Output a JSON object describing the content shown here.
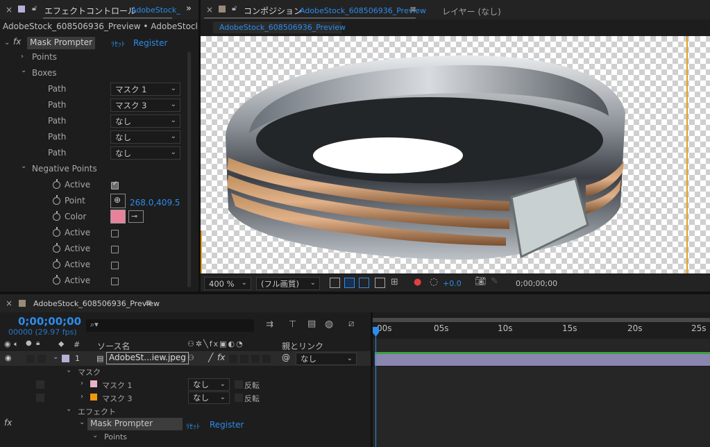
{
  "effect_panel": {
    "tab_title": "エフェクトコントロール",
    "tab_source": "AdobeStock_",
    "breadcrumb": "AdobeStock_608506936_Preview • AdobeStock_60",
    "effect_name": "Mask Prompter",
    "reset": "ﾘｾｯﾄ",
    "register": "Register",
    "points": "Points",
    "boxes": "Boxes",
    "path_rows": [
      {
        "label": "Path",
        "value": "マスク 1"
      },
      {
        "label": "Path",
        "value": "マスク 3"
      },
      {
        "label": "Path",
        "value": "なし"
      },
      {
        "label": "Path",
        "value": "なし"
      },
      {
        "label": "Path",
        "value": "なし"
      }
    ],
    "negative_points": "Negative Points",
    "active1": "Active",
    "point_label": "Point",
    "point_value": "268.0,409.5",
    "color_label": "Color",
    "color_value": "#e8829a",
    "active_rows": [
      "Active",
      "Active",
      "Active",
      "Active"
    ]
  },
  "comp_panel": {
    "tab_title": "コンポジション",
    "tab_source": "AdobeStock_608506936_Preview",
    "layer_tab": "レイヤー (なし)",
    "sub_tab": "AdobeStock_608506936_Preview",
    "zoom": "400 %",
    "resolution": "(フル画質)",
    "exposure": "+0.0",
    "timecode": "0;00;00;00"
  },
  "timeline": {
    "tab_title": "AdobeStock_608506936_Preview",
    "timecode": "0;00;00;00",
    "frames": "00000 (29.97 fps)",
    "search_placeholder": "",
    "col_source": "ソース名",
    "col_parent": "親とリンク",
    "col_num": "#",
    "ruler": [
      "00s",
      "05s",
      "10s",
      "15s",
      "20s",
      "25s"
    ],
    "layer": {
      "num": "1",
      "name": "AdobeSt...iew.jpeg",
      "parent": "なし"
    },
    "mask_group": "マスク",
    "masks": [
      {
        "name": "マスク 1",
        "mode": "なし",
        "invert": "反転",
        "color": "#e8b4c8"
      },
      {
        "name": "マスク 3",
        "mode": "なし",
        "invert": "反転",
        "color": "#f0960f"
      }
    ],
    "effect_group": "エフェクト",
    "effect_name": "Mask Prompter",
    "reset": "ﾘｾｯﾄ",
    "register": "Register",
    "points": "Points"
  },
  "colors": {
    "accent": "#2d8ceb",
    "layer_bar": "#8a86b0",
    "mask1": "#e8b4c8",
    "mask3": "#f0960f"
  }
}
